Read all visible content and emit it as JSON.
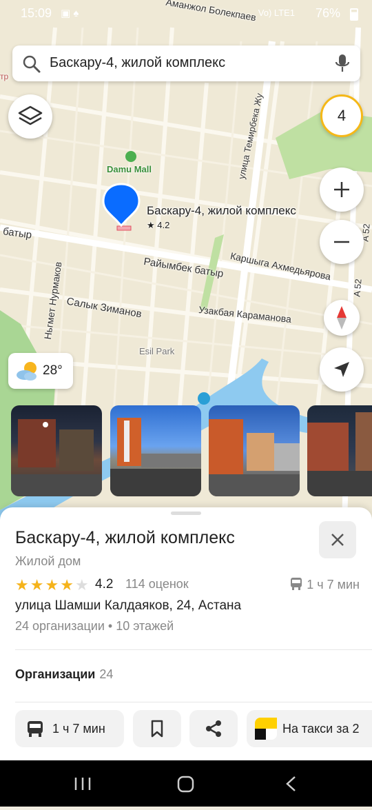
{
  "status_bar": {
    "time": "15:09",
    "battery": "76%",
    "network": "Vo) LTE1"
  },
  "search": {
    "query": "Баскару-4, жилой комплекс"
  },
  "map": {
    "cluster_count": "4",
    "weather_temp": "28°",
    "labels": {
      "street_top": "Аманжол Болекпаев",
      "damu_mall": "Damu Mall",
      "temirbek": "улица Темирбека Жу",
      "batyr": "батыр",
      "raiymbek": "Райымбек батыр",
      "karshyga": "Каршыга Ахмедьярова",
      "nurmakov": "Ньгмет Нурмаков",
      "salyk": "Салык Зиманов",
      "uzakbai": "Узакбая Караманова",
      "esil_park": "Esil Park",
      "a52_a": "A 52",
      "a52_b": "A 52",
      "edge_left": "тр"
    },
    "pin": {
      "title": "Баскару-4, жилой комплекс",
      "rating": "★ 4.2"
    }
  },
  "place": {
    "title": "Баскару-4, жилой комплекс",
    "category": "Жилой дом",
    "rating": "4.2",
    "stars": 4,
    "reviews": "114 оценок",
    "transit_time": "1 ч 7 мин",
    "address": "улица Шамши Калдаяков, 24, Астана",
    "meta": "24 организации • 10 этажей",
    "orgs_label": "Организации",
    "orgs_count": "24"
  },
  "actions": {
    "route": "1 ч 7 мин",
    "taxi": "На такси за 2"
  },
  "colors": {
    "accent_yellow": "#f5b818",
    "pin_blue": "#0a6cff",
    "star": "#f5b31b"
  }
}
